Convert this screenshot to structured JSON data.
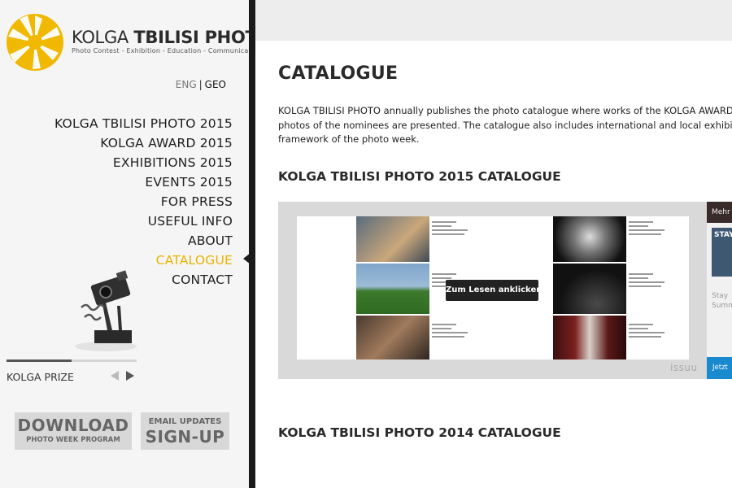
{
  "logo": {
    "title_light": "KOLGA",
    "title_bold": "TBILISI PHOTO",
    "subtitle": "Photo Contest - Exhibition - Education - Communication"
  },
  "lang": {
    "eng": "ENG",
    "separator": "|",
    "geo": "GEO"
  },
  "nav": {
    "items": [
      {
        "label": "KOLGA TBILISI PHOTO 2015"
      },
      {
        "label": "KOLGA AWARD 2015"
      },
      {
        "label": "EXHIBITIONS 2015"
      },
      {
        "label": "EVENTS 2015"
      },
      {
        "label": "FOR PRESS"
      },
      {
        "label": "USEFUL INFO"
      },
      {
        "label": "ABOUT"
      },
      {
        "label": "CATALOGUE",
        "active": true
      },
      {
        "label": "CONTACT"
      }
    ]
  },
  "prize": {
    "label": "KOLGA PRIZE",
    "slider_position": 0.5
  },
  "buttons": {
    "download_big": "DOWNLOAD",
    "download_small": "PHOTO WEEK PROGRAM",
    "signup_small": "EMAIL UPDATES",
    "signup_big": "SIGN-UP"
  },
  "main": {
    "title": "CATALOGUE",
    "intro_line1": "KOLGA TBILISI PHOTO annually publishes the photo catalogue where works of the KOLGA AWARD win",
    "intro_line2": "photos of the nominees are presented. The catalogue also includes international and local exhibitions p",
    "intro_line3": "framework of the photo week.",
    "section_2015": "KOLGA TBILISI PHOTO 2015 CATALOGUE",
    "section_2014": "KOLGA TBILISI PHOTO 2014 CATALOGUE"
  },
  "viewer": {
    "read_button": "Zum Lesen anklicken",
    "brand": "issuu",
    "ad_top": "Mehr",
    "ad_image_text": "STAY",
    "ad_text_line1": "Stay",
    "ad_text_line2": "Summ",
    "ad_button": "Jetzt"
  },
  "colors": {
    "accent": "#e8b400",
    "divider": "#1a1a1a",
    "issuu_blue": "#1a8ad0"
  }
}
